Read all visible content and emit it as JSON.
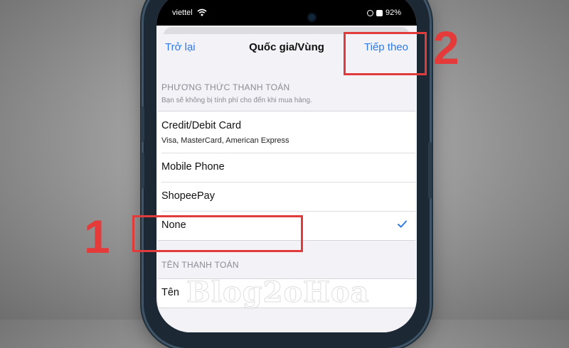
{
  "status_bar": {
    "carrier": "viettel",
    "battery": "92%"
  },
  "nav": {
    "back_label": "Trở lại",
    "title": "Quốc gia/Vùng",
    "next_label": "Tiếp theo"
  },
  "payment_section": {
    "header": "PHƯƠNG THỨC THANH TOÁN",
    "subtitle": "Bạn sẽ không bị tính phí cho đến khi mua hàng.",
    "options": [
      {
        "label": "Credit/Debit Card",
        "sub": "Visa, MasterCard, American Express"
      },
      {
        "label": "Mobile Phone"
      },
      {
        "label": "ShopeePay"
      },
      {
        "label": "None",
        "selected": true
      }
    ]
  },
  "billing_section": {
    "header": "TÊN THANH TOÁN",
    "rows": [
      {
        "label": "Tên"
      }
    ]
  },
  "annotations": {
    "step1": "1",
    "step2": "2",
    "color": "#e23b3b"
  },
  "watermark": "Blog2oHoa",
  "colors": {
    "accent": "#2f7ae5",
    "background": "#f2f2f7",
    "phone_frame": "#1c2833"
  }
}
